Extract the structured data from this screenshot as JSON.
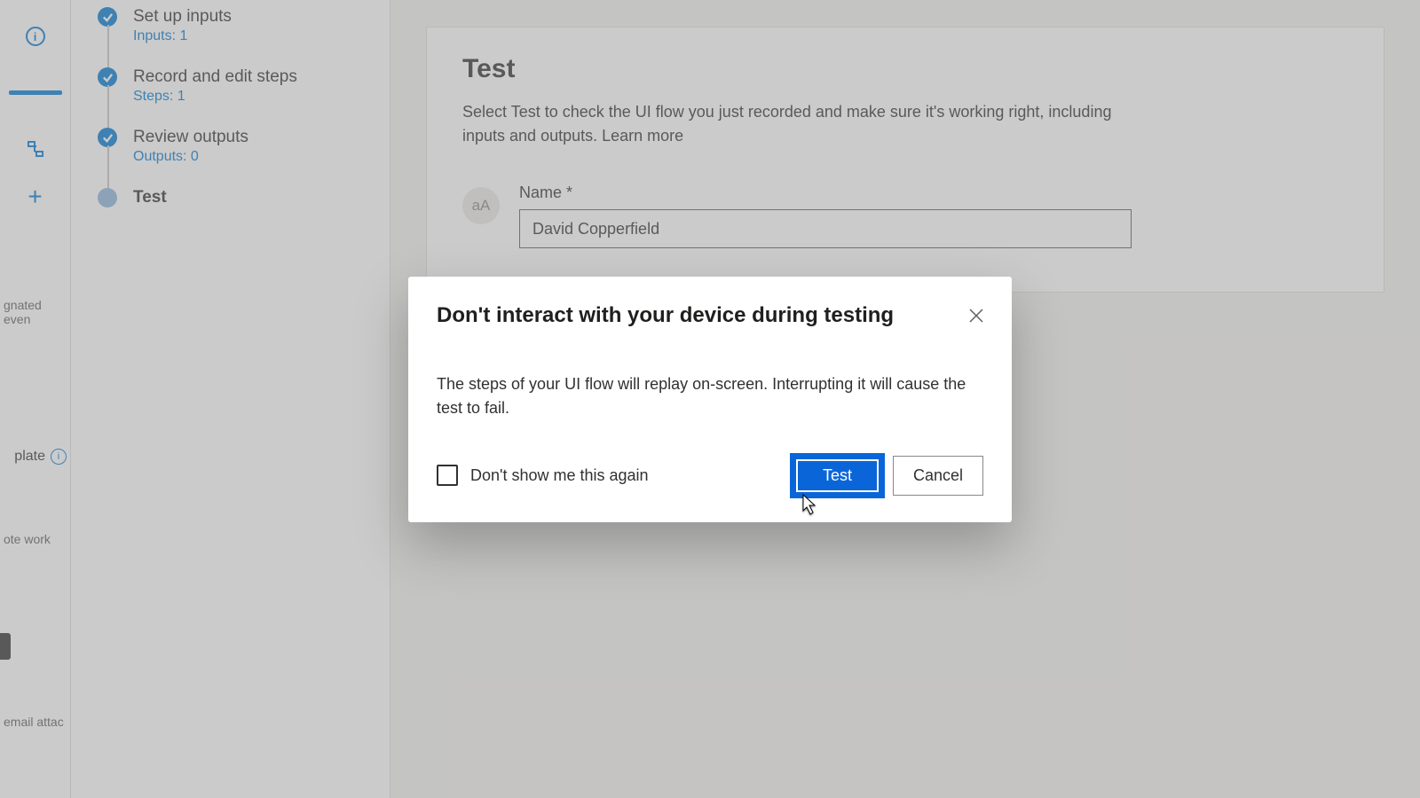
{
  "leftRail": {
    "info": "i",
    "plus": "+",
    "text_events": "gnated even",
    "text_plate": "plate",
    "text_work": "ote work",
    "text_attach": "email attac"
  },
  "steps": [
    {
      "title": "Set up inputs",
      "sub": "Inputs: 1",
      "state": "done"
    },
    {
      "title": "Record and edit steps",
      "sub": "Steps: 1",
      "state": "done"
    },
    {
      "title": "Review outputs",
      "sub": "Outputs: 0",
      "state": "done"
    },
    {
      "title": "Test",
      "sub": "",
      "state": "current"
    }
  ],
  "main": {
    "heading": "Test",
    "descPrefix": "Select Test to check the UI flow you just recorded and make sure it's working right, including inputs and outputs. ",
    "learnMore": "Learn more",
    "nameLabel": "Name ",
    "required": "*",
    "nameValue": "David Copperfield",
    "badgeText": "aA"
  },
  "dialog": {
    "title": "Don't interact with your device during testing",
    "body": "The steps of your UI flow will replay on-screen. Interrupting it will cause the test to fail.",
    "checkboxLabel": "Don't show me this again",
    "primary": "Test",
    "secondary": "Cancel"
  }
}
